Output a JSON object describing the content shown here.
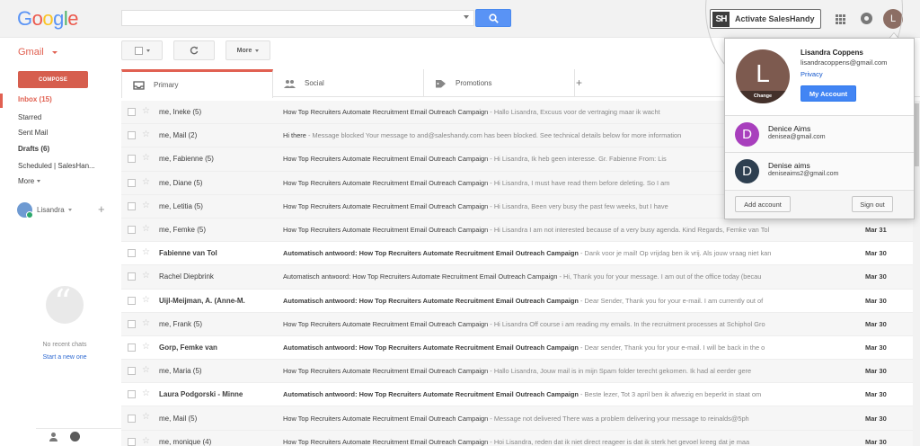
{
  "header": {
    "logo_letters": [
      "G",
      "o",
      "o",
      "g",
      "l",
      "e"
    ],
    "logo_colors": [
      "#4285f4",
      "#ea4335",
      "#fbbc05",
      "#4285f4",
      "#34a853",
      "#ea4335"
    ],
    "search_value": "",
    "search_icon": "magnifier-icon",
    "saleshandy_logo": "SH",
    "saleshandy_label": "Activate SalesHandy",
    "avatar_letter": "L"
  },
  "toolbar": {
    "gmail_label": "Gmail",
    "more_label": "More"
  },
  "nav": {
    "compose_label": "COMPOSE",
    "items": [
      {
        "label": "Inbox (15)",
        "style": "active"
      },
      {
        "label": "Starred",
        "style": "normal"
      },
      {
        "label": "Sent Mail",
        "style": "normal"
      },
      {
        "label": "Drafts (6)",
        "style": "bold"
      },
      {
        "label": "Scheduled | SalesHan...",
        "style": "normal"
      },
      {
        "label": "More",
        "style": "normal"
      }
    ],
    "hangouts_user": "Lisandra",
    "no_chats": "No recent chats",
    "start_new": "Start a new one"
  },
  "tabs": [
    {
      "label": "Primary",
      "icon": "inbox-icon"
    },
    {
      "label": "Social",
      "icon": "people-icon"
    },
    {
      "label": "Promotions",
      "icon": "tag-icon"
    }
  ],
  "messages": [
    {
      "sender": "me, Ineke (5)",
      "subject": "How Top Recruiters Automate Recruitment Email Outreach Campaign",
      "snippet": " - Hallo Lisandra, Excuus voor de vertraging maar ik wacht",
      "date": "",
      "unread": false
    },
    {
      "sender": "me, Mail (2)",
      "subject": "Hi there",
      "snippet": " - Message blocked Your message to and@saleshandy.com has been blocked. See technical details below for more information",
      "date": "",
      "unread": false
    },
    {
      "sender": "me, Fabienne (5)",
      "subject": "How Top Recruiters Automate Recruitment Email Outreach Campaign",
      "snippet": " - Hi Lisandra, Ik heb geen interesse. Gr. Fabienne From: Lis",
      "date": "",
      "unread": false
    },
    {
      "sender": "me, Diane (5)",
      "subject": "How Top Recruiters Automate Recruitment Email Outreach Campaign",
      "snippet": " - Hi Lisandra, I must have read them before deleting. So I am",
      "date": "",
      "unread": false
    },
    {
      "sender": "me, Letitia (5)",
      "subject": "How Top Recruiters Automate Recruitment Email Outreach Campaign",
      "snippet": " - Hi Lisandra, Been very busy the past few weeks, but I have",
      "date": "",
      "unread": false
    },
    {
      "sender": "me, Femke (5)",
      "subject": "How Top Recruiters Automate Recruitment Email Outreach Campaign",
      "snippet": " - Hi Lisandra I am not interested because of a very busy agenda. Kind Regards, Femke van Tol",
      "date": "Mar 31",
      "unread": false
    },
    {
      "sender": "Fabienne van Tol",
      "subject": "Automatisch antwoord: How Top Recruiters Automate Recruitment Email Outreach Campaign",
      "snippet": " - Dank voor je mail! Op vrijdag ben ik vrij. Als jouw vraag niet kan",
      "date": "Mar 30",
      "unread": true
    },
    {
      "sender": "Rachel Diepbrink",
      "subject": "Automatisch antwoord: How Top Recruiters Automate Recruitment Email Outreach Campaign",
      "snippet": " - Hi, Thank you for your message. I am out of the office today (becau",
      "date": "Mar 30",
      "unread": false
    },
    {
      "sender": "Uijl-Meijman, A. (Anne-M.",
      "subject": "Automatisch antwoord: How Top Recruiters Automate Recruitment Email Outreach Campaign",
      "snippet": " - Dear Sender, Thank you for your e-mail. I am currently out of",
      "date": "Mar 30",
      "unread": true
    },
    {
      "sender": "me, Frank (5)",
      "subject": "How Top Recruiters Automate Recruitment Email Outreach Campaign",
      "snippet": " - Hi Lisandra Off course i am reading my emails. In the recruitment processes at Schiphol Gro",
      "date": "Mar 30",
      "unread": false
    },
    {
      "sender": "Gorp, Femke van",
      "subject": "Automatisch antwoord: How Top Recruiters Automate Recruitment Email Outreach Campaign",
      "snippet": " - Dear sender, Thank you for your e-mail. I will be back in the o",
      "date": "Mar 30",
      "unread": true
    },
    {
      "sender": "me, Maria (5)",
      "subject": "How Top Recruiters Automate Recruitment Email Outreach Campaign",
      "snippet": " - Hallo Lisandra, Jouw mail is in mijn Spam folder terecht gekomen. Ik had al eerder gere",
      "date": "Mar 30",
      "unread": false
    },
    {
      "sender": "Laura Podgorski - Minne",
      "subject": "Automatisch antwoord: How Top Recruiters Automate Recruitment Email Outreach Campaign",
      "snippet": " - Beste lezer, Tot 3 april ben ik afwezig en beperkt in staat om",
      "date": "Mar 30",
      "unread": true
    },
    {
      "sender": "me, Mail (5)",
      "subject": "How Top Recruiters Automate Recruitment Email Outreach Campaign",
      "snippet": " - Message not delivered There was a problem delivering your message to reinalds@5ph",
      "date": "Mar 30",
      "unread": false
    },
    {
      "sender": "me, monique (4)",
      "subject": "How Top Recruiters Automate Recruitment Email Outreach Campaign",
      "snippet": " - Hoi Lisandra, reden dat ik niet direct reageer is dat ik sterk het gevoel kreeg dat je maa",
      "date": "Mar 30",
      "unread": false
    }
  ],
  "account": {
    "name": "Lisandra Coppens",
    "email": "lisandracoppens@gmail.com",
    "privacy": "Privacy",
    "my_account": "My Account",
    "change": "Change",
    "avatar_letter": "L",
    "others": [
      {
        "name": "Denice Aims",
        "email": "denisea@gmail.com",
        "letter": "D",
        "color": "#a83fbd"
      },
      {
        "name": "Denise aims",
        "email": "deniseaims2@gmail.com",
        "letter": "D",
        "color": "#2e3f50"
      }
    ],
    "add_account": "Add account",
    "sign_out": "Sign out"
  }
}
